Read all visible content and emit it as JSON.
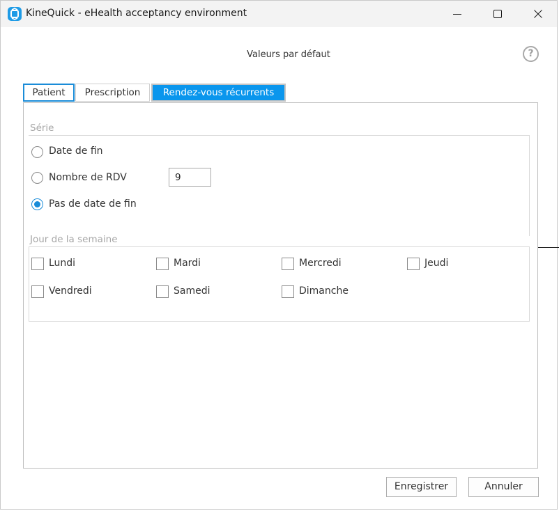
{
  "window": {
    "title": "KineQuick - eHealth acceptancy environment",
    "controls": [
      "minimize-icon",
      "maximize-icon",
      "close-icon"
    ]
  },
  "dialog": {
    "title": "Valeurs par défaut",
    "help": "?"
  },
  "tabs": [
    {
      "label": "Patient",
      "state": "focused"
    },
    {
      "label": "Prescription",
      "state": "normal"
    },
    {
      "label": "Rendez-vous récurrents",
      "state": "selected"
    }
  ],
  "serie": {
    "title": "Série",
    "options": [
      {
        "label": "Date de fin",
        "checked": false
      },
      {
        "label": "Nombre de RDV",
        "checked": false
      },
      {
        "label": "Pas de date de fin",
        "checked": true
      }
    ],
    "count_value": "9"
  },
  "weekdays": {
    "title": "Jour de la semaine",
    "days": [
      {
        "label": "Lundi",
        "checked": false
      },
      {
        "label": "Mardi",
        "checked": false
      },
      {
        "label": "Mercredi",
        "checked": false
      },
      {
        "label": "Jeudi",
        "checked": false
      },
      {
        "label": "Vendredi",
        "checked": false
      },
      {
        "label": "Samedi",
        "checked": false
      },
      {
        "label": "Dimanche",
        "checked": false
      }
    ]
  },
  "footer": {
    "save_label": "Enregistrer",
    "cancel_label": "Annuler"
  },
  "colors": {
    "accent": "#0a96ed",
    "focus_border": "#1a8cd8",
    "app_icon": "#1e9be6"
  }
}
